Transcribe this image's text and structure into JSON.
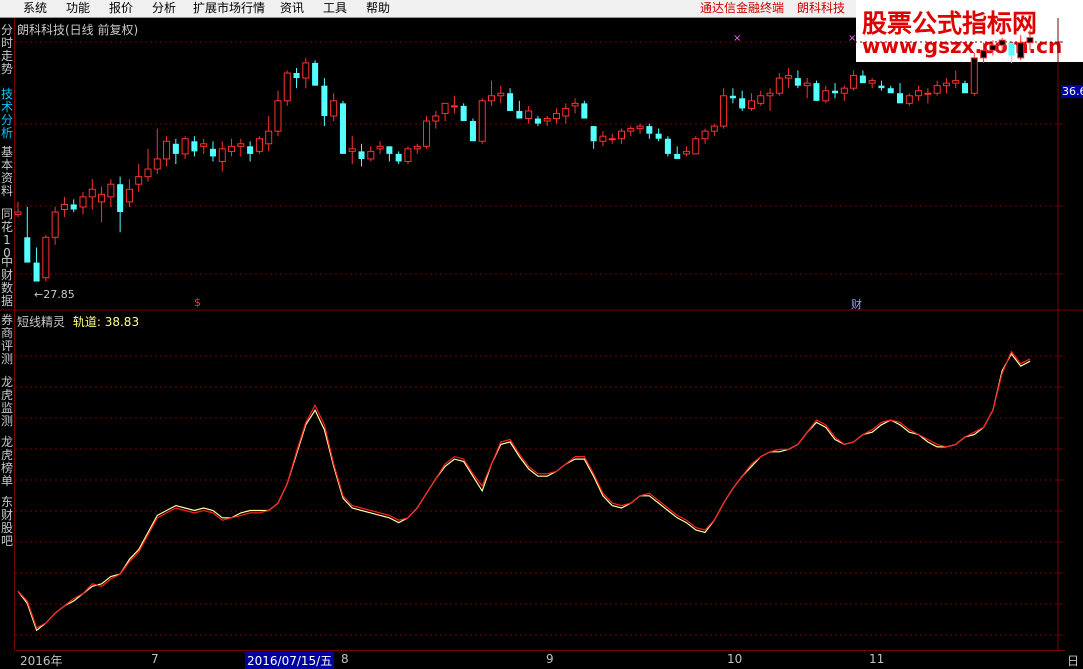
{
  "menu": {
    "items": [
      "系统",
      "功能",
      "报价",
      "分析",
      "扩展市场行情",
      "资讯",
      "工具",
      "帮助"
    ],
    "right_items": [
      "通达信金融终端",
      "朗科科技"
    ]
  },
  "watermark": {
    "line1": "股票公式指标网",
    "line2": "www.gszx.com.cn"
  },
  "sidebar": {
    "items": [
      {
        "label": "分时走势",
        "active": false
      },
      {
        "label": "技术分析",
        "active": true
      },
      {
        "label": "基本资料",
        "active": false
      },
      {
        "label": "同花10",
        "active": false
      },
      {
        "label": "中财数据",
        "active": false
      },
      {
        "label": "券商评测",
        "active": false
      },
      {
        "label": "龙虎监测",
        "active": false
      },
      {
        "label": "龙虎榜单",
        "active": false
      },
      {
        "label": "东财股吧",
        "active": false
      }
    ]
  },
  "main_panel": {
    "title": "朗科科技(日线 前复权)",
    "price_tag": "36.6",
    "low_marker": "27.85",
    "event_marks": [
      "$",
      "财"
    ]
  },
  "indicator_panel": {
    "name": "短线精灵",
    "param_label": "轨道:",
    "param_value": "38.83"
  },
  "x_axis": {
    "labels": [
      "2016年",
      "7",
      "2016/07/15/五",
      "8",
      "9",
      "10",
      "11"
    ],
    "right_label": "日"
  },
  "colors": {
    "up": "#ff3030",
    "down": "#54ffff",
    "grid": "#7a0000",
    "line1": "#ff2020",
    "line2": "#ffffa0"
  },
  "chart_data": {
    "type": "candlestick",
    "ohlc": [
      [
        30.5,
        31.0,
        30.4,
        30.6
      ],
      [
        29.6,
        30.8,
        29.2,
        28.6
      ],
      [
        28.6,
        29.2,
        27.9,
        27.85
      ],
      [
        28.0,
        29.7,
        27.85,
        29.6
      ],
      [
        29.6,
        30.8,
        29.3,
        30.6
      ],
      [
        30.7,
        31.2,
        30.4,
        30.9
      ],
      [
        30.9,
        31.1,
        30.6,
        30.7
      ],
      [
        30.8,
        31.4,
        30.5,
        31.2
      ],
      [
        31.2,
        31.9,
        30.7,
        31.5
      ],
      [
        31.0,
        31.6,
        30.2,
        31.3
      ],
      [
        31.2,
        31.9,
        30.8,
        31.7
      ],
      [
        31.7,
        32.0,
        29.8,
        30.6
      ],
      [
        31.0,
        31.9,
        30.8,
        31.5
      ],
      [
        31.7,
        32.5,
        31.4,
        32.0
      ],
      [
        32.0,
        33.1,
        31.8,
        32.3
      ],
      [
        32.3,
        33.9,
        32.1,
        32.7
      ],
      [
        32.7,
        33.6,
        32.4,
        33.4
      ],
      [
        33.3,
        33.5,
        32.5,
        32.9
      ],
      [
        32.9,
        33.6,
        32.7,
        33.5
      ],
      [
        33.4,
        33.6,
        32.8,
        33.0
      ],
      [
        33.2,
        33.5,
        32.9,
        33.3
      ],
      [
        33.1,
        33.4,
        32.6,
        32.8
      ],
      [
        32.6,
        33.4,
        32.2,
        33.1
      ],
      [
        33.0,
        33.5,
        32.8,
        33.2
      ],
      [
        33.2,
        33.5,
        32.8,
        33.3
      ],
      [
        33.2,
        33.4,
        32.6,
        32.9
      ],
      [
        33.0,
        33.6,
        32.9,
        33.5
      ],
      [
        33.3,
        34.4,
        33.0,
        33.8
      ],
      [
        33.8,
        35.4,
        33.6,
        35.0
      ],
      [
        35.0,
        36.2,
        34.8,
        36.1
      ],
      [
        36.1,
        36.3,
        35.5,
        35.9
      ],
      [
        35.9,
        36.7,
        35.5,
        36.5
      ],
      [
        36.5,
        36.6,
        35.7,
        35.6
      ],
      [
        35.6,
        35.9,
        34.0,
        34.4
      ],
      [
        34.4,
        35.3,
        34.2,
        35.0
      ],
      [
        34.9,
        35.0,
        33.9,
        32.9
      ],
      [
        33.0,
        33.6,
        32.5,
        33.1
      ],
      [
        33.0,
        33.3,
        32.4,
        32.7
      ],
      [
        32.7,
        33.2,
        32.6,
        33.0
      ],
      [
        33.1,
        33.4,
        32.9,
        33.2
      ],
      [
        33.2,
        33.2,
        32.6,
        32.9
      ],
      [
        32.9,
        33.0,
        32.5,
        32.6
      ],
      [
        32.6,
        33.2,
        32.5,
        33.1
      ],
      [
        33.1,
        33.3,
        32.9,
        33.2
      ],
      [
        33.2,
        34.4,
        33.1,
        34.2
      ],
      [
        34.2,
        34.6,
        33.9,
        34.4
      ],
      [
        34.5,
        34.9,
        34.2,
        34.9
      ],
      [
        34.8,
        35.2,
        34.5,
        34.8
      ],
      [
        34.8,
        34.9,
        34.3,
        34.2
      ],
      [
        34.2,
        34.3,
        33.6,
        33.4
      ],
      [
        33.4,
        35.1,
        33.3,
        35.0
      ],
      [
        35.0,
        35.8,
        34.8,
        35.2
      ],
      [
        35.2,
        35.6,
        34.9,
        35.3
      ],
      [
        35.3,
        35.5,
        34.6,
        34.6
      ],
      [
        34.6,
        35.0,
        34.4,
        34.3
      ],
      [
        34.3,
        34.8,
        34.1,
        34.6
      ],
      [
        34.3,
        34.4,
        34.0,
        34.1
      ],
      [
        34.2,
        34.4,
        34.0,
        34.3
      ],
      [
        34.3,
        34.7,
        34.1,
        34.5
      ],
      [
        34.4,
        34.9,
        34.1,
        34.7
      ],
      [
        34.8,
        35.1,
        34.5,
        34.9
      ],
      [
        34.9,
        35.0,
        34.3,
        34.3
      ],
      [
        34.0,
        34.0,
        33.1,
        33.4
      ],
      [
        33.4,
        33.8,
        33.2,
        33.6
      ],
      [
        33.5,
        33.7,
        33.3,
        33.5
      ],
      [
        33.5,
        33.9,
        33.3,
        33.8
      ],
      [
        33.8,
        34.0,
        33.6,
        33.9
      ],
      [
        33.9,
        34.1,
        33.7,
        34.0
      ],
      [
        34.0,
        34.1,
        33.5,
        33.7
      ],
      [
        33.7,
        33.9,
        33.4,
        33.5
      ],
      [
        33.5,
        33.6,
        32.8,
        32.9
      ],
      [
        32.9,
        33.2,
        32.9,
        32.7
      ],
      [
        32.9,
        33.2,
        32.8,
        33.0
      ],
      [
        32.9,
        33.6,
        32.9,
        33.5
      ],
      [
        33.5,
        33.9,
        33.3,
        33.8
      ],
      [
        33.8,
        34.1,
        33.6,
        34.0
      ],
      [
        34.0,
        35.5,
        33.9,
        35.2
      ],
      [
        35.2,
        35.5,
        34.9,
        35.1
      ],
      [
        35.1,
        35.4,
        34.6,
        34.7
      ],
      [
        34.7,
        35.3,
        34.6,
        35.0
      ],
      [
        34.9,
        35.4,
        34.8,
        35.2
      ],
      [
        35.2,
        35.5,
        34.6,
        35.3
      ],
      [
        35.3,
        36.1,
        35.2,
        35.9
      ],
      [
        35.9,
        36.3,
        35.5,
        36.0
      ],
      [
        35.9,
        36.2,
        35.5,
        35.6
      ],
      [
        35.6,
        35.9,
        35.1,
        35.7
      ],
      [
        35.7,
        35.8,
        35.0,
        35.0
      ],
      [
        35.0,
        35.6,
        34.9,
        35.4
      ],
      [
        35.4,
        35.7,
        35.1,
        35.3
      ],
      [
        35.3,
        35.6,
        35.0,
        35.5
      ],
      [
        35.5,
        36.2,
        35.4,
        36.0
      ],
      [
        36.0,
        36.2,
        35.7,
        35.7
      ],
      [
        35.7,
        35.9,
        35.5,
        35.8
      ],
      [
        35.6,
        35.8,
        35.4,
        35.5
      ],
      [
        35.5,
        35.6,
        35.4,
        35.3
      ],
      [
        35.3,
        35.7,
        35.0,
        34.9
      ],
      [
        34.9,
        35.3,
        34.8,
        35.2
      ],
      [
        35.2,
        35.6,
        35.0,
        35.4
      ],
      [
        35.3,
        35.5,
        34.9,
        35.3
      ],
      [
        35.3,
        35.8,
        35.2,
        35.6
      ],
      [
        35.6,
        35.9,
        35.3,
        35.7
      ],
      [
        35.7,
        36.2,
        35.5,
        35.8
      ],
      [
        35.7,
        35.8,
        35.4,
        35.3
      ],
      [
        35.3,
        36.9,
        35.2,
        36.7
      ],
      [
        36.7,
        37.3,
        36.5,
        37.0
      ],
      [
        37.0,
        37.4,
        36.8,
        37.2
      ],
      [
        37.2,
        37.5,
        37.0,
        37.4
      ],
      [
        37.3,
        37.3,
        36.5,
        36.8
      ],
      [
        36.7,
        37.6,
        36.6,
        37.3
      ],
      [
        37.3,
        37.8,
        37.0,
        37.5
      ]
    ],
    "indicator": {
      "series": [
        {
          "name": "短线精灵",
          "values": [
            30.6,
            30.35,
            29.8,
            29.95,
            30.15,
            30.3,
            30.4,
            30.55,
            30.7,
            30.75,
            30.9,
            30.95,
            31.25,
            31.45,
            31.8,
            32.15,
            32.25,
            32.35,
            32.3,
            32.25,
            32.3,
            32.25,
            32.1,
            32.1,
            32.2,
            32.25,
            32.25,
            32.25,
            32.4,
            32.8,
            33.4,
            34.0,
            34.3,
            33.9,
            33.15,
            32.5,
            32.3,
            32.25,
            32.2,
            32.15,
            32.1,
            32.0,
            32.1,
            32.3,
            32.6,
            32.9,
            33.15,
            33.3,
            33.25,
            32.95,
            32.65,
            33.2,
            33.6,
            33.65,
            33.35,
            33.1,
            32.95,
            32.95,
            33.05,
            33.2,
            33.3,
            33.3,
            32.95,
            32.55,
            32.35,
            32.3,
            32.4,
            32.55,
            32.55,
            32.4,
            32.25,
            32.1,
            32.0,
            31.85,
            31.8,
            32.05,
            32.4,
            32.7,
            32.95,
            33.15,
            33.35,
            33.45,
            33.45,
            33.5,
            33.6,
            33.85,
            34.05,
            33.95,
            33.7,
            33.6,
            33.65,
            33.8,
            33.85,
            34.0,
            34.1,
            34.0,
            33.85,
            33.8,
            33.65,
            33.55,
            33.55,
            33.6,
            33.75,
            33.8,
            33.95,
            34.3,
            35.1,
            35.45,
            35.2,
            35.3
          ]
        },
        {
          "name": "轨道",
          "values": [
            30.6,
            30.4,
            29.85,
            29.95,
            30.15,
            30.3,
            30.45,
            30.55,
            30.75,
            30.7,
            30.85,
            30.95,
            31.2,
            31.4,
            31.75,
            32.1,
            32.2,
            32.3,
            32.25,
            32.2,
            32.25,
            32.2,
            32.05,
            32.1,
            32.15,
            32.2,
            32.2,
            32.25,
            32.4,
            32.8,
            33.45,
            34.05,
            34.4,
            34.0,
            33.2,
            32.55,
            32.35,
            32.3,
            32.25,
            32.2,
            32.15,
            32.05,
            32.1,
            32.3,
            32.6,
            32.9,
            33.2,
            33.35,
            33.3,
            33.0,
            32.75,
            33.2,
            33.65,
            33.7,
            33.4,
            33.15,
            33.0,
            33.0,
            33.05,
            33.2,
            33.35,
            33.35,
            33.0,
            32.6,
            32.4,
            32.35,
            32.4,
            32.55,
            32.6,
            32.45,
            32.3,
            32.15,
            32.05,
            31.9,
            31.85,
            32.05,
            32.4,
            32.7,
            32.95,
            33.2,
            33.35,
            33.45,
            33.5,
            33.5,
            33.6,
            33.85,
            34.1,
            34.0,
            33.75,
            33.6,
            33.65,
            33.8,
            33.9,
            34.05,
            34.1,
            34.05,
            33.9,
            33.8,
            33.7,
            33.6,
            33.55,
            33.6,
            33.75,
            33.85,
            33.95,
            34.3,
            35.05,
            35.5,
            35.25,
            35.35
          ]
        }
      ],
      "last_value": 38.83
    },
    "ylim_price": [
      27.0,
      38.0
    ],
    "ylim_indicator": [
      29.5,
      36.0
    ],
    "grid": true
  }
}
